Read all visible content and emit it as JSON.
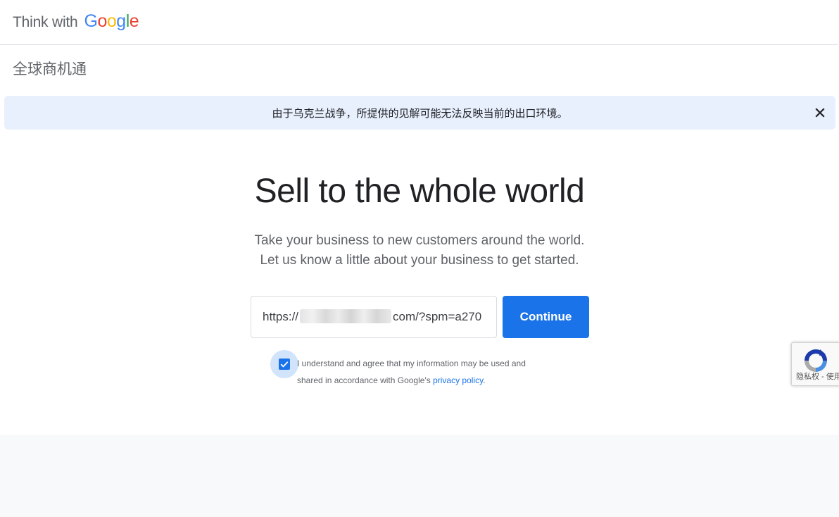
{
  "header": {
    "brand_prefix": "Think with",
    "brand_letters": [
      "G",
      "o",
      "o",
      "g",
      "l",
      "e"
    ],
    "brand_colors": [
      "#4285f4",
      "#ea4335",
      "#fbbc05",
      "#4285f4",
      "#34a853",
      "#ea4335"
    ]
  },
  "page": {
    "subtitle": "全球商机通"
  },
  "banner": {
    "message": "由于乌克兰战争，所提供的见解可能无法反映当前的出口环境。",
    "close_icon": "close-icon"
  },
  "hero": {
    "title": "Sell to the whole world",
    "description_line1": "Take your business to new customers around the world.",
    "description_line2": "Let us know a little about your business to get started."
  },
  "form": {
    "url_prefix": "https://",
    "url_suffix": "com/?spm=a270",
    "continue_label": "Continue"
  },
  "consent": {
    "checked": true,
    "text": "I understand and agree that my information may be used and shared in accordance with Google's",
    "link": "privacy policy",
    "end": "."
  },
  "recaptcha": {
    "icon": "recaptcha-icon",
    "text": "隐私权 - 使用条款"
  },
  "colors": {
    "accent": "#1a73e8",
    "banner_bg": "#e8f0fe"
  }
}
